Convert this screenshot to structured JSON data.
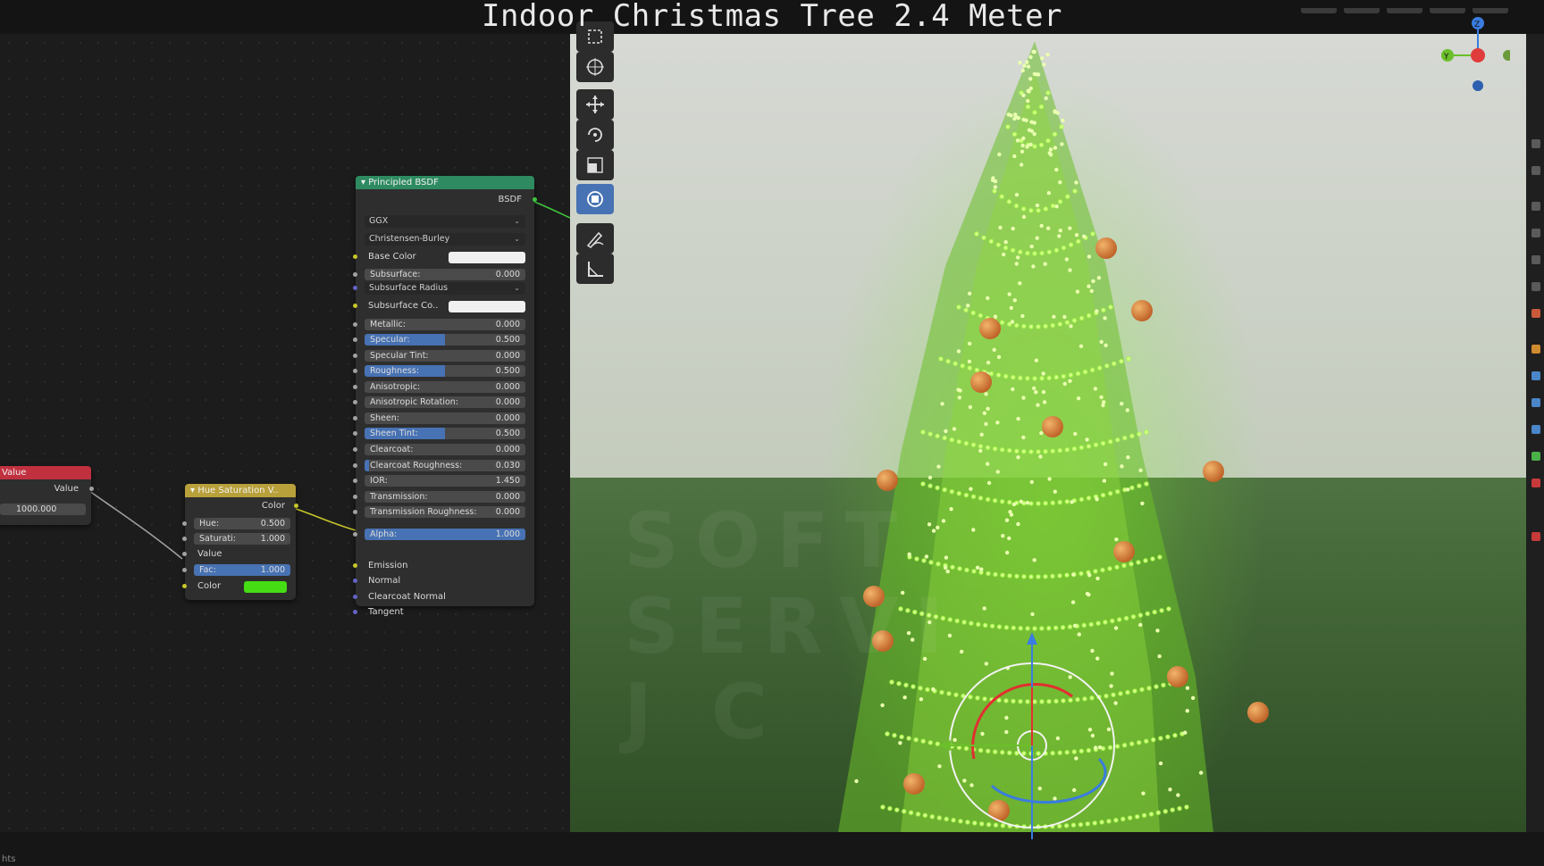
{
  "title": "Indoor Christmas Tree 2.4 Meter",
  "status_text": "hts",
  "watermark": [
    "SOFT",
    "SERVI",
    "J C"
  ],
  "colors": {
    "value_header": "#c0303e",
    "hue_header": "#b8a03a",
    "bsdf_header": "#2e8a60",
    "accent_blue": "#4772b3",
    "tree_green": "#8cff3c",
    "color_swatch": "#46dc14"
  },
  "value_node": {
    "title": "Value",
    "output": "Value",
    "value": "1000.000"
  },
  "hue_node": {
    "title": "Hue Saturation V..",
    "output": "Color",
    "hue_label": "Hue:",
    "hue_value": "0.500",
    "sat_label": "Saturati:",
    "sat_value": "1.000",
    "value_label": "Value",
    "fac_label": "Fac:",
    "fac_value": "1.000",
    "color_label": "Color"
  },
  "bsdf_node": {
    "title": "Principled BSDF",
    "output": "BSDF",
    "distribution": "GGX",
    "subsurface_method": "Christensen-Burley",
    "base_color_label": "Base Color",
    "subsurface_color_label": "Subsurface Co..",
    "subsurface_radius_label": "Subsurface Radius",
    "fields": [
      {
        "label": "Subsurface:",
        "value": "0.000",
        "fill": 0
      },
      {
        "label": "Metallic:",
        "value": "0.000",
        "fill": 0
      },
      {
        "label": "Specular:",
        "value": "0.500",
        "fill": 0.5
      },
      {
        "label": "Specular Tint:",
        "value": "0.000",
        "fill": 0
      },
      {
        "label": "Roughness:",
        "value": "0.500",
        "fill": 0.5
      },
      {
        "label": "Anisotropic:",
        "value": "0.000",
        "fill": 0
      },
      {
        "label": "Anisotropic Rotation:",
        "value": "0.000",
        "fill": 0
      },
      {
        "label": "Sheen:",
        "value": "0.000",
        "fill": 0
      },
      {
        "label": "Sheen Tint:",
        "value": "0.500",
        "fill": 0.5
      },
      {
        "label": "Clearcoat:",
        "value": "0.000",
        "fill": 0
      },
      {
        "label": "Clearcoat Roughness:",
        "value": "0.030",
        "fill": 0.03
      },
      {
        "label": "IOR:",
        "value": "1.450",
        "fill": 0
      },
      {
        "label": "Transmission:",
        "value": "0.000",
        "fill": 0
      },
      {
        "label": "Transmission Roughness:",
        "value": "0.000",
        "fill": 0
      },
      {
        "label": "Alpha:",
        "value": "1.000",
        "fill": 1
      }
    ],
    "inputs": [
      "Emission",
      "Normal",
      "Clearcoat Normal",
      "Tangent"
    ]
  },
  "toolbar": [
    "select-box",
    "cursor",
    "move",
    "rotate",
    "scale",
    "transform",
    "annotate",
    "measure"
  ],
  "toolbar_active": "transform",
  "gizmo": {
    "z_label": "Z",
    "y_label": "Y"
  }
}
